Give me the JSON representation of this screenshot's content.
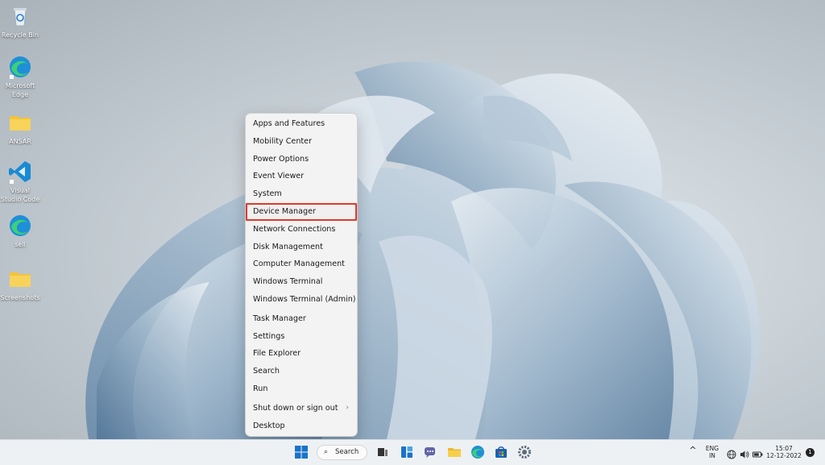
{
  "desktop_icons": [
    {
      "label": "Recycle Bin",
      "icon": "recycle-bin-icon"
    },
    {
      "label": "Microsoft Edge",
      "icon": "edge-icon"
    },
    {
      "label": "ANSAR",
      "icon": "folder-icon"
    },
    {
      "label": "Visual Studio Code",
      "icon": "vscode-icon"
    },
    {
      "label": "sell",
      "icon": "edge-icon"
    },
    {
      "label": "Screenshots",
      "icon": "folder-icon"
    }
  ],
  "menu": {
    "items": [
      {
        "label": "Apps and Features"
      },
      {
        "label": "Mobility Center"
      },
      {
        "label": "Power Options"
      },
      {
        "label": "Event Viewer"
      },
      {
        "label": "System"
      },
      {
        "label": "Device Manager",
        "highlighted": true
      },
      {
        "label": "Network Connections"
      },
      {
        "label": "Disk Management"
      },
      {
        "label": "Computer Management"
      },
      {
        "label": "Windows Terminal"
      },
      {
        "label": "Windows Terminal (Admin)"
      },
      {
        "label": "Task Manager"
      },
      {
        "label": "Settings"
      },
      {
        "label": "File Explorer"
      },
      {
        "label": "Search"
      },
      {
        "label": "Run"
      },
      {
        "label": "Shut down or sign out",
        "submenu_chevron": "›"
      },
      {
        "label": "Desktop"
      }
    ]
  },
  "taskbar": {
    "search_label": "Search",
    "search_icon": "⌕",
    "tray": {
      "language": "ENG",
      "region": "IN",
      "time": "15:07",
      "date": "12-12-2022",
      "notification_count": "1",
      "chevron_up": "^"
    }
  },
  "colors": {
    "highlight_outline": "#e0382a",
    "accent_blue": "#1a73c9"
  }
}
